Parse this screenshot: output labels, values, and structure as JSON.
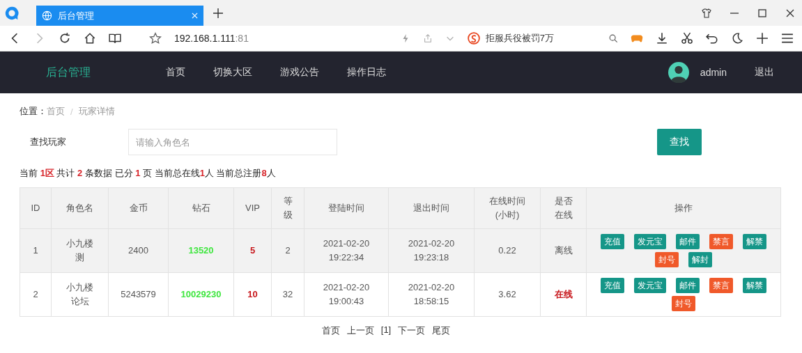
{
  "browser": {
    "tab_title": "后台管理",
    "url_host": "192.168.1.111",
    "url_port": ":81",
    "news": "拒服兵役被罚7万"
  },
  "header": {
    "brand": "后台管理",
    "nav": [
      {
        "label": "首页"
      },
      {
        "label": "切换大区"
      },
      {
        "label": "游戏公告"
      },
      {
        "label": "操作日志"
      }
    ],
    "user": "admin",
    "logout": "退出"
  },
  "breadcrumb": {
    "prefix": "位置：",
    "items": [
      "首页",
      "玩家详情"
    ],
    "separator": "/"
  },
  "search": {
    "label": "查找玩家",
    "placeholder": "请输入角色名",
    "button": "查找"
  },
  "summary": "当前 **1区** 共计 **2** 条数据 已分 **1** 页 当前总在线**1**人 当前总注册**8**人",
  "table": {
    "columns": [
      "ID",
      "角色名",
      "金币",
      "钻石",
      "VIP",
      "等级",
      "登陆时间",
      "退出时间",
      "在线时间\n(小时)",
      "是否在线",
      "操作"
    ],
    "rows": [
      {
        "id": "1",
        "name": "小九楼测",
        "gold": "2400",
        "diamond": "13520",
        "vip": "5",
        "level": "2",
        "login": "2021-02-20 19:22:34",
        "logout": "2021-02-20 19:23:18",
        "hours": "0.22",
        "status": "离线",
        "online": false,
        "actions": [
          {
            "label": "充值",
            "kind": "normal"
          },
          {
            "label": "发元宝",
            "kind": "normal"
          },
          {
            "label": "邮件",
            "kind": "normal"
          },
          {
            "label": "禁言",
            "kind": "warning"
          },
          {
            "label": "解禁",
            "kind": "normal"
          },
          {
            "label": "封号",
            "kind": "warning"
          },
          {
            "label": "解封",
            "kind": "normal"
          }
        ]
      },
      {
        "id": "2",
        "name": "小九楼论坛",
        "gold": "5243579",
        "diamond": "10029230",
        "vip": "10",
        "level": "32",
        "login": "2021-02-20 19:00:43",
        "logout": "2021-02-20 18:58:15",
        "hours": "3.62",
        "status": "在线",
        "online": true,
        "actions": [
          {
            "label": "充值",
            "kind": "normal"
          },
          {
            "label": "发元宝",
            "kind": "normal"
          },
          {
            "label": "邮件",
            "kind": "normal"
          },
          {
            "label": "禁言",
            "kind": "warning"
          },
          {
            "label": "解禁",
            "kind": "normal"
          },
          {
            "label": "封号",
            "kind": "warning"
          }
        ]
      }
    ]
  },
  "pagination": [
    "首页",
    "上一页",
    "[1]",
    "下一页",
    "尾页"
  ]
}
